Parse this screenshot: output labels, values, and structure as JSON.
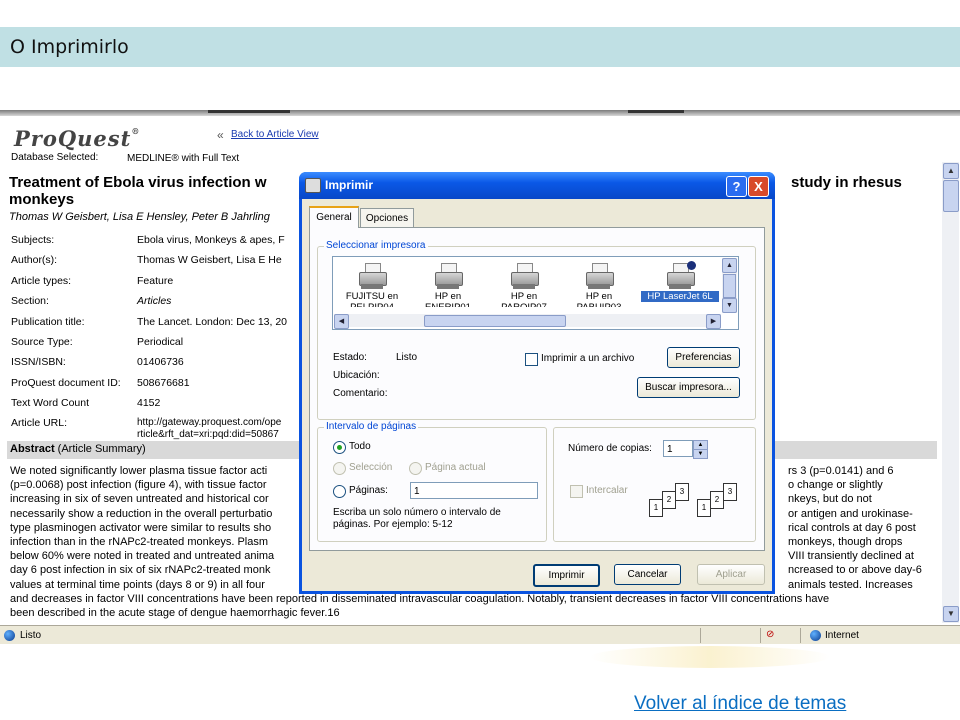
{
  "slide": {
    "title": "O Imprimirlo",
    "footer_link": "Volver al índice de temas"
  },
  "proquest": {
    "logo": "ProQuest",
    "logo_mark": "®",
    "back_arrows": "«",
    "back_link": "Back to Article View",
    "db_label": "Database Selected:",
    "db_value": "MEDLINE® with Full Text",
    "title_line1": "Treatment of Ebola virus infection w",
    "title_line1_end": "study in rhesus",
    "title_line2": "monkeys",
    "authors": "Thomas W Geisbert, Lisa E Hensley, Peter B Jahrling",
    "fields": [
      {
        "label": "Subjects:",
        "value": "Ebola virus,  Monkeys & apes,  F"
      },
      {
        "label": "Author(s):",
        "value": "Thomas W Geisbert,  Lisa E He"
      },
      {
        "label": "Article types:",
        "value": "Feature"
      },
      {
        "label": "Section:",
        "value": "Articles"
      },
      {
        "label": "Publication title:",
        "value": "The Lancet. London: Dec 13, 20"
      },
      {
        "label": "Source Type:",
        "value": "Periodical"
      },
      {
        "label": "ISSN/ISBN:",
        "value": "01406736"
      },
      {
        "label": "ProQuest document ID:",
        "value": "508676681"
      },
      {
        "label": "Text Word Count",
        "value": "4152"
      },
      {
        "label": "Article URL:",
        "value": "http://gateway.proquest.com/ope"
      }
    ],
    "url_line2": "rticle&rft_dat=xri:pqd:did=50867",
    "abstract_bold": "Abstract",
    "abstract_rest": " (Article Summary)",
    "abstract_left": [
      "We noted significantly lower plasma tissue factor acti",
      "(p=0.0068) post infection (figure 4), with tissue factor",
      "increasing in six of seven untreated and historical cor",
      "necessarily show a reduction in the overall perturbatio",
      "type plasminogen activator were similar to results sho",
      "infection than in the rNAPc2-treated monkeys. Plasm",
      "below 60% were noted in treated and untreated anima",
      "day 6 post infection in six of six rNAPc2-treated monk",
      "values at terminal time points (days 8 or 9) in all four"
    ],
    "abstract_right": [
      "rs 3 (p=0.0141) and 6",
      "o change or slightly",
      "nkeys, but do not",
      "or antigen and urokinase-",
      "rical controls at day 6 post",
      "monkeys, though drops",
      "VIII transiently declined at",
      "ncreased to or above day-6",
      "animals tested. Increases"
    ],
    "abstract_full": [
      "and decreases in factor VIII concentrations have been reported in disseminated intravascular coagulation. Notably, transient decreases in factor VIII concentrations have",
      "been described in the acute stage of dengue haemorrhagic fever.16"
    ]
  },
  "statusbar": {
    "status": "Listo",
    "zone": "Internet"
  },
  "dialog": {
    "title": "Imprimir",
    "help": "?",
    "close": "X",
    "tabs": [
      "General",
      "Opciones"
    ],
    "group_printer": "Seleccionar impresora",
    "printers": [
      {
        "name": "FUJITSU en",
        "sub": "PELPIP04",
        "selected": false
      },
      {
        "name": "HP en",
        "sub": "ENERIP01",
        "selected": false
      },
      {
        "name": "HP en",
        "sub": "PAROIP07",
        "selected": false
      },
      {
        "name": "HP en",
        "sub": "PABUIP03",
        "selected": false
      },
      {
        "name": "HP LaserJet 6L",
        "sub": "",
        "selected": true
      }
    ],
    "estado_label": "Estado:",
    "estado_value": "Listo",
    "ubicacion_label": "Ubicación:",
    "comentario_label": "Comentario:",
    "print_to_file": "Imprimir a un archivo",
    "preferences_btn": "Preferencias",
    "find_printer_btn": "Buscar impresora...",
    "group_range": "Intervalo de páginas",
    "range_all": "Todo",
    "range_selection": "Selección",
    "range_current": "Página actual",
    "range_pages": "Páginas:",
    "pages_value": "1",
    "range_hint_1": "Escriba un solo número o intervalo de",
    "range_hint_2": "páginas. Por ejemplo: 5-12",
    "copies_label": "Número de copias:",
    "copies_value": "1",
    "collate_label": "Intercalar",
    "print_btn": "Imprimir",
    "cancel_btn": "Cancelar",
    "apply_btn": "Aplicar"
  }
}
